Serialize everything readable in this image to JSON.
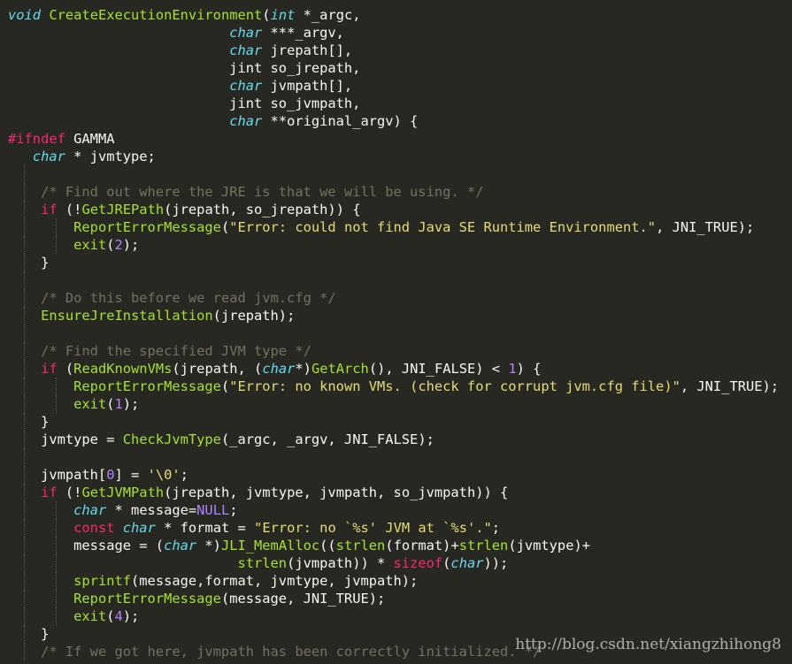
{
  "editor": {
    "background": "#272822",
    "token_colors": {
      "keyword": "#f92672",
      "type": "#66d9ef",
      "function": "#a6e22e",
      "string": "#e6db74",
      "number": "#ae81ff",
      "comment": "#75715e",
      "plain": "#f8f8f2"
    },
    "lines": [
      {
        "guides": 0,
        "tokens": [
          [
            "ty",
            "void"
          ],
          [
            "pl",
            " "
          ],
          [
            "fn",
            "CreateExecutionEnvironment"
          ],
          [
            "pl",
            "("
          ],
          [
            "ty",
            "int"
          ],
          [
            "pl",
            " *_argc,"
          ]
        ]
      },
      {
        "guides": 0,
        "tokens": [
          [
            "pl",
            "                           "
          ],
          [
            "ty",
            "char"
          ],
          [
            "pl",
            " ***_argv,"
          ]
        ]
      },
      {
        "guides": 0,
        "tokens": [
          [
            "pl",
            "                           "
          ],
          [
            "ty",
            "char"
          ],
          [
            "pl",
            " jrepath[],"
          ]
        ]
      },
      {
        "guides": 0,
        "tokens": [
          [
            "pl",
            "                           jint so_jrepath,"
          ]
        ]
      },
      {
        "guides": 0,
        "tokens": [
          [
            "pl",
            "                           "
          ],
          [
            "ty",
            "char"
          ],
          [
            "pl",
            " jvmpath[],"
          ]
        ]
      },
      {
        "guides": 0,
        "tokens": [
          [
            "pl",
            "                           jint so_jvmpath,"
          ]
        ]
      },
      {
        "guides": 0,
        "tokens": [
          [
            "pl",
            "                           "
          ],
          [
            "ty",
            "char"
          ],
          [
            "pl",
            " **original_argv) {"
          ]
        ]
      },
      {
        "guides": 0,
        "tokens": [
          [
            "kw",
            "#ifndef"
          ],
          [
            "pl",
            " GAMMA"
          ]
        ]
      },
      {
        "guides": 0,
        "tokens": [
          [
            "pl",
            "   "
          ],
          [
            "ty",
            "char"
          ],
          [
            "pl",
            " * jvmtype;"
          ]
        ]
      },
      {
        "guides": 1,
        "tokens": [
          [
            "pl",
            ""
          ]
        ]
      },
      {
        "guides": 1,
        "tokens": [
          [
            "pl",
            "    "
          ],
          [
            "cm",
            "/* Find out where the JRE is that we will be using. */"
          ]
        ]
      },
      {
        "guides": 1,
        "tokens": [
          [
            "pl",
            "    "
          ],
          [
            "kw",
            "if"
          ],
          [
            "pl",
            " (!"
          ],
          [
            "fn",
            "GetJREPath"
          ],
          [
            "pl",
            "(jrepath, so_jrepath)) {"
          ]
        ]
      },
      {
        "guides": 2,
        "tokens": [
          [
            "pl",
            "        "
          ],
          [
            "fn",
            "ReportErrorMessage"
          ],
          [
            "pl",
            "("
          ],
          [
            "st",
            "\"Error: could not find Java SE Runtime Environment.\""
          ],
          [
            "pl",
            ", JNI_TRUE);"
          ]
        ]
      },
      {
        "guides": 2,
        "tokens": [
          [
            "pl",
            "        "
          ],
          [
            "fn",
            "exit"
          ],
          [
            "pl",
            "("
          ],
          [
            "nu",
            "2"
          ],
          [
            "pl",
            ");"
          ]
        ]
      },
      {
        "guides": 1,
        "tokens": [
          [
            "pl",
            "    }"
          ]
        ]
      },
      {
        "guides": 1,
        "tokens": [
          [
            "pl",
            ""
          ]
        ]
      },
      {
        "guides": 1,
        "tokens": [
          [
            "pl",
            "    "
          ],
          [
            "cm",
            "/* Do this before we read jvm.cfg */"
          ]
        ]
      },
      {
        "guides": 1,
        "tokens": [
          [
            "pl",
            "    "
          ],
          [
            "fn",
            "EnsureJreInstallation"
          ],
          [
            "pl",
            "(jrepath);"
          ]
        ]
      },
      {
        "guides": 1,
        "tokens": [
          [
            "pl",
            ""
          ]
        ]
      },
      {
        "guides": 1,
        "tokens": [
          [
            "pl",
            "    "
          ],
          [
            "cm",
            "/* Find the specified JVM type */"
          ]
        ]
      },
      {
        "guides": 1,
        "tokens": [
          [
            "pl",
            "    "
          ],
          [
            "kw",
            "if"
          ],
          [
            "pl",
            " ("
          ],
          [
            "fn",
            "ReadKnownVMs"
          ],
          [
            "pl",
            "(jrepath, ("
          ],
          [
            "ty",
            "char"
          ],
          [
            "pl",
            "*)"
          ],
          [
            "fn",
            "GetArch"
          ],
          [
            "pl",
            "(), JNI_FALSE) < "
          ],
          [
            "nu",
            "1"
          ],
          [
            "pl",
            ") {"
          ]
        ]
      },
      {
        "guides": 2,
        "tokens": [
          [
            "pl",
            "        "
          ],
          [
            "fn",
            "ReportErrorMessage"
          ],
          [
            "pl",
            "("
          ],
          [
            "st",
            "\"Error: no known VMs. (check for corrupt jvm.cfg file)\""
          ],
          [
            "pl",
            ", JNI_TRUE);"
          ]
        ]
      },
      {
        "guides": 2,
        "tokens": [
          [
            "pl",
            "        "
          ],
          [
            "fn",
            "exit"
          ],
          [
            "pl",
            "("
          ],
          [
            "nu",
            "1"
          ],
          [
            "pl",
            ");"
          ]
        ]
      },
      {
        "guides": 1,
        "tokens": [
          [
            "pl",
            "    }"
          ]
        ]
      },
      {
        "guides": 1,
        "tokens": [
          [
            "pl",
            "    jvmtype = "
          ],
          [
            "fn",
            "CheckJvmType"
          ],
          [
            "pl",
            "(_argc, _argv, JNI_FALSE);"
          ]
        ]
      },
      {
        "guides": 1,
        "tokens": [
          [
            "pl",
            ""
          ]
        ]
      },
      {
        "guides": 1,
        "tokens": [
          [
            "pl",
            "    jvmpath["
          ],
          [
            "nu",
            "0"
          ],
          [
            "pl",
            "] = "
          ],
          [
            "st",
            "'\\0'"
          ],
          [
            "pl",
            ";"
          ]
        ]
      },
      {
        "guides": 1,
        "tokens": [
          [
            "pl",
            "    "
          ],
          [
            "kw",
            "if"
          ],
          [
            "pl",
            " (!"
          ],
          [
            "fn",
            "GetJVMPath"
          ],
          [
            "pl",
            "(jrepath, jvmtype, jvmpath, so_jvmpath)) {"
          ]
        ]
      },
      {
        "guides": 2,
        "tokens": [
          [
            "pl",
            "        "
          ],
          [
            "ty",
            "char"
          ],
          [
            "pl",
            " * message="
          ],
          [
            "nu",
            "NULL"
          ],
          [
            "pl",
            ";"
          ]
        ]
      },
      {
        "guides": 2,
        "tokens": [
          [
            "pl",
            "        "
          ],
          [
            "kw",
            "const"
          ],
          [
            "pl",
            " "
          ],
          [
            "ty",
            "char"
          ],
          [
            "pl",
            " * format = "
          ],
          [
            "st",
            "\"Error: no `%s' JVM at `%s'.\""
          ],
          [
            "pl",
            ";"
          ]
        ]
      },
      {
        "guides": 2,
        "tokens": [
          [
            "pl",
            "        message = ("
          ],
          [
            "ty",
            "char"
          ],
          [
            "pl",
            " *)"
          ],
          [
            "fn",
            "JLI_MemAlloc"
          ],
          [
            "pl",
            "(("
          ],
          [
            "fn",
            "strlen"
          ],
          [
            "pl",
            "(format)+"
          ],
          [
            "fn",
            "strlen"
          ],
          [
            "pl",
            "(jvmtype)+"
          ]
        ]
      },
      {
        "guides": 2,
        "tokens": [
          [
            "pl",
            "                            "
          ],
          [
            "fn",
            "strlen"
          ],
          [
            "pl",
            "(jvmpath)) * "
          ],
          [
            "kw",
            "sizeof"
          ],
          [
            "pl",
            "("
          ],
          [
            "ty",
            "char"
          ],
          [
            "pl",
            "));"
          ]
        ]
      },
      {
        "guides": 2,
        "tokens": [
          [
            "pl",
            "        "
          ],
          [
            "fn",
            "sprintf"
          ],
          [
            "pl",
            "(message,format, jvmtype, jvmpath);"
          ]
        ]
      },
      {
        "guides": 2,
        "tokens": [
          [
            "pl",
            "        "
          ],
          [
            "fn",
            "ReportErrorMessage"
          ],
          [
            "pl",
            "(message, JNI_TRUE);"
          ]
        ]
      },
      {
        "guides": 2,
        "tokens": [
          [
            "pl",
            "        "
          ],
          [
            "fn",
            "exit"
          ],
          [
            "pl",
            "("
          ],
          [
            "nu",
            "4"
          ],
          [
            "pl",
            ");"
          ]
        ]
      },
      {
        "guides": 1,
        "tokens": [
          [
            "pl",
            "    }"
          ]
        ]
      },
      {
        "guides": 1,
        "tokens": [
          [
            "pl",
            "    "
          ],
          [
            "cm",
            "/* If we got here, jvmpath has been correctly initialized. */"
          ]
        ]
      }
    ]
  },
  "watermark": {
    "text": "http://blog.csdn.net/xiangzhihong8"
  }
}
